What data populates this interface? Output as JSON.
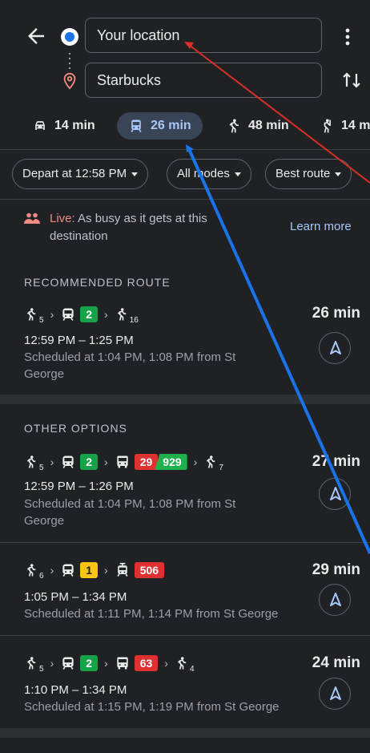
{
  "search": {
    "origin_value": "Your location",
    "destination_value": "Starbucks"
  },
  "modes": [
    {
      "icon": "car-icon",
      "label": "14 min"
    },
    {
      "icon": "transit-icon",
      "label": "26 min",
      "active": true
    },
    {
      "icon": "walk-icon",
      "label": "48 min"
    },
    {
      "icon": "rideshare-icon",
      "label": "14 m"
    }
  ],
  "chips": {
    "depart": "Depart at 12:58 PM",
    "modes": "All modes",
    "route": "Best route"
  },
  "live": {
    "prefix": "Live:",
    "text": " As busy as it gets at this destination",
    "learn_more": "Learn more"
  },
  "recommended": {
    "title": "RECOMMENDED ROUTE",
    "route": {
      "walk1": "5",
      "line1": "2",
      "walk2": "16",
      "duration": "26 min",
      "time_range": "12:59 PM – 1:25 PM",
      "schedule": "Scheduled at 1:04 PM, 1:08 PM from St George"
    }
  },
  "other": {
    "title": "OTHER OPTIONS",
    "routes": [
      {
        "walk1": "5",
        "line1": "2",
        "line2": "29",
        "line3": "929",
        "walk2": "7",
        "duration": "27 min",
        "time_range": "12:59 PM – 1:26 PM",
        "schedule": "Scheduled at 1:04 PM, 1:08 PM from St George"
      },
      {
        "walk1": "6",
        "line1": "1",
        "line2": "506",
        "duration": "29 min",
        "time_range": "1:05 PM – 1:34 PM",
        "schedule": "Scheduled at 1:11 PM, 1:14 PM from St George"
      },
      {
        "walk1": "5",
        "line1": "2",
        "line2": "63",
        "walk2": "4",
        "duration": "24 min",
        "time_range": "1:10 PM – 1:34 PM",
        "schedule": "Scheduled at 1:15 PM, 1:19 PM from St George"
      }
    ]
  },
  "colors": {
    "background": "#202124",
    "accent": "#a8c7fa",
    "line_green": "#15a34a",
    "line_yellow": "#f9c413",
    "line_red": "#e03131",
    "live_red": "#f28b82"
  }
}
